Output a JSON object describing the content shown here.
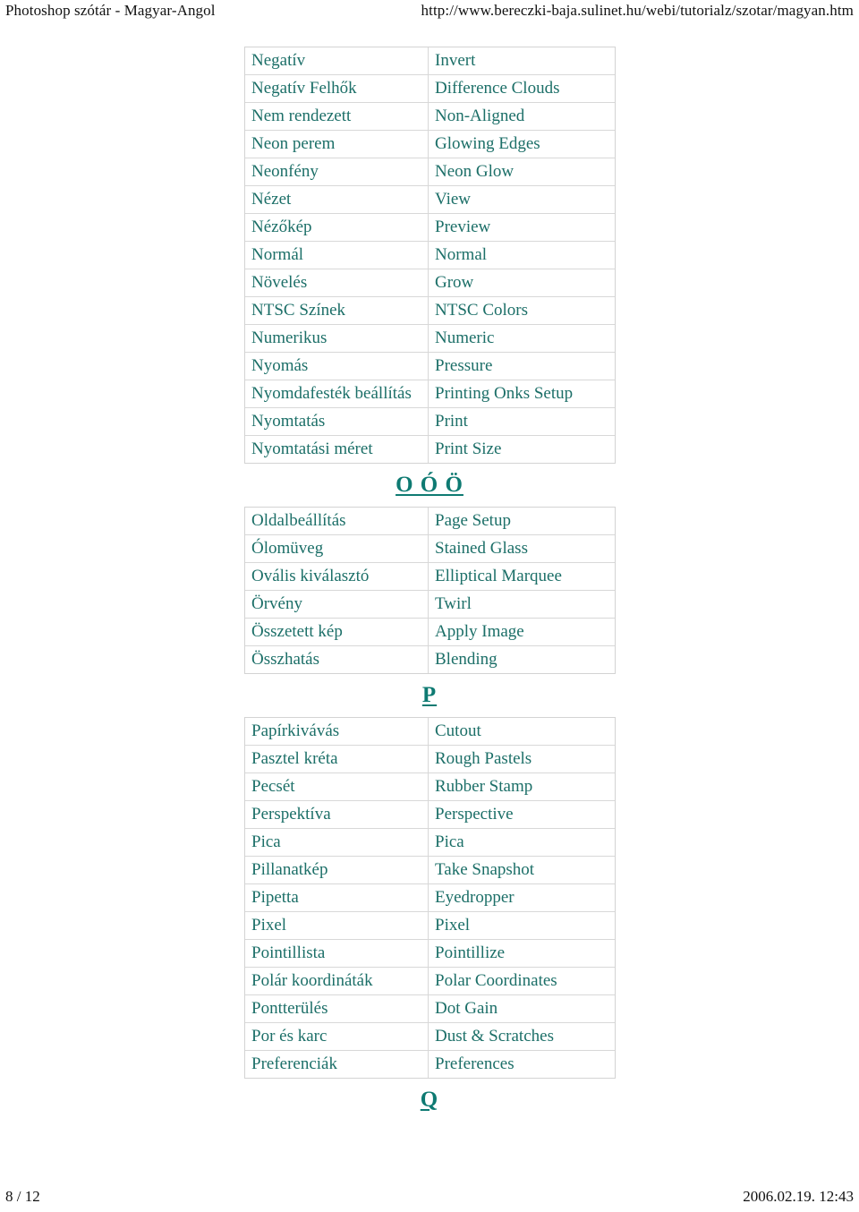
{
  "document": {
    "header_left": "Photoshop szótár - Magyar-Angol",
    "header_right": "http://www.bereczki-baja.sulinet.hu/webi/tutorialz/szotar/magyan.htm",
    "footer_left": "8 / 12",
    "footer_right": "2006.02.19. 12:43",
    "text_color": "#1c6f68",
    "heading_color": "#0e7a72",
    "border_color": "#d8d8d8"
  },
  "sections": [
    {
      "id": "section-n",
      "heading": "",
      "rows": [
        {
          "hu": "Negatív",
          "en": "Invert"
        },
        {
          "hu": "Negatív Felhők",
          "en": "Difference Clouds"
        },
        {
          "hu": "Nem rendezett",
          "en": "Non-Aligned"
        },
        {
          "hu": "Neon perem",
          "en": "Glowing Edges"
        },
        {
          "hu": "Neonfény",
          "en": "Neon Glow"
        },
        {
          "hu": "Nézet",
          "en": "View"
        },
        {
          "hu": "Nézőkép",
          "en": "Preview"
        },
        {
          "hu": "Normál",
          "en": "Normal"
        },
        {
          "hu": "Növelés",
          "en": "Grow"
        },
        {
          "hu": "NTSC Színek",
          "en": "NTSC Colors"
        },
        {
          "hu": "Numerikus",
          "en": "Numeric"
        },
        {
          "hu": "Nyomás",
          "en": "Pressure"
        },
        {
          "hu": "Nyomdafesték beállítás",
          "en": "Printing Onks Setup"
        },
        {
          "hu": "Nyomtatás",
          "en": "Print"
        },
        {
          "hu": "Nyomtatási méret",
          "en": "Print Size"
        }
      ]
    },
    {
      "id": "section-o",
      "heading": "O Ó Ö",
      "rows": [
        {
          "hu": "Oldalbeállítás",
          "en": " Page Setup"
        },
        {
          "hu": "Ólomüveg",
          "en": "Stained Glass"
        },
        {
          "hu": "Ovális kiválasztó",
          "en": "Elliptical Marquee"
        },
        {
          "hu": "Örvény",
          "en": "Twirl"
        },
        {
          "hu": "Összetett kép",
          "en": "Apply Image"
        },
        {
          "hu": "Összhatás",
          "en": "Blending"
        }
      ]
    },
    {
      "id": "section-p",
      "heading": "P",
      "rows": [
        {
          "hu": "Papírkivávás",
          "en": "Cutout"
        },
        {
          "hu": "Pasztel kréta",
          "en": "Rough Pastels"
        },
        {
          "hu": "Pecsét",
          "en": "Rubber Stamp"
        },
        {
          "hu": "Perspektíva",
          "en": "Perspective"
        },
        {
          "hu": "Pica",
          "en": "Pica"
        },
        {
          "hu": "Pillanatkép",
          "en": "Take Snapshot"
        },
        {
          "hu": "Pipetta",
          "en": "Eyedropper"
        },
        {
          "hu": "Pixel",
          "en": "Pixel"
        },
        {
          "hu": "Pointillista",
          "en": "Pointillize"
        },
        {
          "hu": "Polár koordináták",
          "en": "Polar Coordinates"
        },
        {
          "hu": "Pontterülés",
          "en": "Dot Gain"
        },
        {
          "hu": "Por és karc",
          "en": "Dust & Scratches"
        },
        {
          "hu": "Preferenciák",
          "en": "Preferences"
        }
      ]
    },
    {
      "id": "section-q",
      "heading": "Q",
      "rows": []
    }
  ]
}
